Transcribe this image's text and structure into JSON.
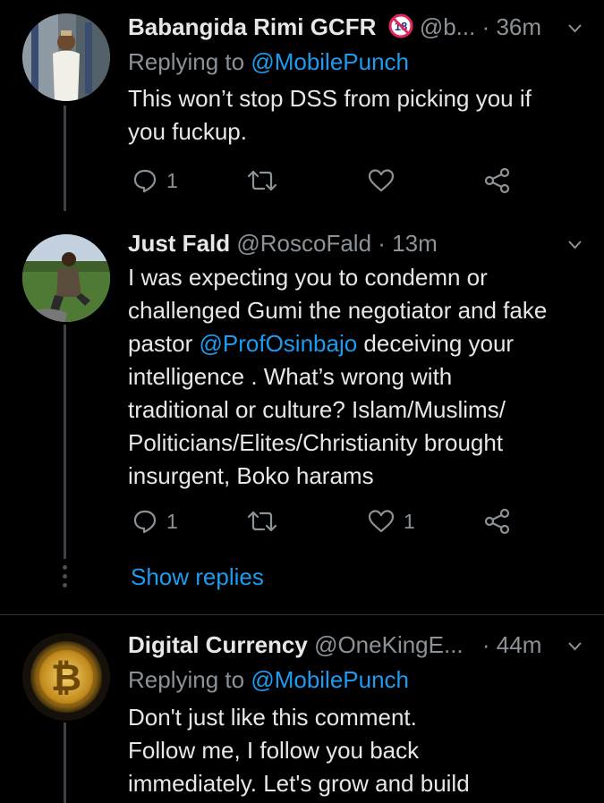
{
  "tweets": [
    {
      "name": "Babangida Rimi GCFR",
      "badge": "18",
      "handle": "@b...",
      "time": "· 36m",
      "replying_prefix": "Replying to ",
      "replying_handle": "@MobilePunch",
      "text": "This won’t stop DSS from picking you if\nyou fuckup.",
      "reply_count": "1",
      "retweet_count": "",
      "like_count": ""
    },
    {
      "name": "Just Fald",
      "handle": "@RoscoFald",
      "time": "· 13m",
      "text_part1": "I was expecting you to condemn or\nchallenged Gumi the negotiator and fake\npastor ",
      "mention": "@ProfOsinbajo",
      "text_part2": " deceiving your\nintelligence . What’s wrong with\ntraditional or culture? Islam/Muslims/\nPoliticians/Elites/Christianity brought\ninsurgent, Boko harams",
      "reply_count": "1",
      "retweet_count": "",
      "like_count": "1",
      "show_replies": "Show replies"
    },
    {
      "name": "Digital Currency",
      "handle": "@OneKingE...",
      "time": "· 44m",
      "replying_prefix": "Replying to ",
      "replying_handle": "@MobilePunch",
      "text": "Don't just like this comment.\nFollow me, I follow you back\nimmediately. Let's grow and build"
    }
  ],
  "icons": {
    "reply": "reply-icon",
    "retweet": "retweet-icon",
    "like": "heart-icon",
    "share": "share-icon",
    "menu": "chevron-down-icon"
  },
  "colors": {
    "background": "#000000",
    "link": "#1d9bf0",
    "muted": "#8b9298",
    "text": "#e7e7e7"
  }
}
